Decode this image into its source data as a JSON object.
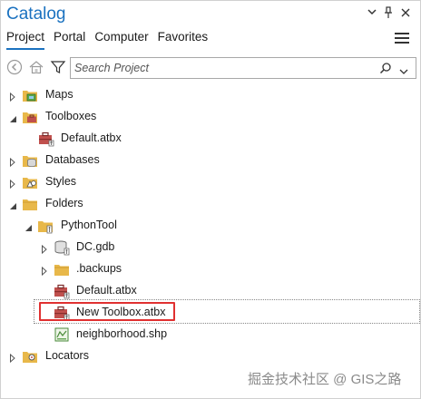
{
  "pane": {
    "title": "Catalog",
    "controls": {
      "dropdown": "▾",
      "pin": "📌",
      "close": "✕"
    }
  },
  "tabs": [
    {
      "label": "Project",
      "active": true
    },
    {
      "label": "Portal",
      "active": false
    },
    {
      "label": "Computer",
      "active": false
    },
    {
      "label": "Favorites",
      "active": false
    }
  ],
  "toolbar": {
    "search_placeholder": "Search Project",
    "search_value": ""
  },
  "tree": {
    "maps": "Maps",
    "toolboxes": "Toolboxes",
    "default_atbx_root": "Default.atbx",
    "databases": "Databases",
    "styles": "Styles",
    "folders": "Folders",
    "pythontool": "PythonTool",
    "dc_gdb": "DC.gdb",
    "backups": ".backups",
    "default_atbx": "Default.atbx",
    "new_toolbox": "New Toolbox.atbx",
    "neighborhood": "neighborhood.shp",
    "locators": "Locators"
  },
  "watermark": "掘金技术社区 @ GIS之路",
  "colors": {
    "accent": "#1b72c0",
    "highlight": "#e03030",
    "folder": "#e8b84a",
    "toolbox": "#c0504d"
  }
}
